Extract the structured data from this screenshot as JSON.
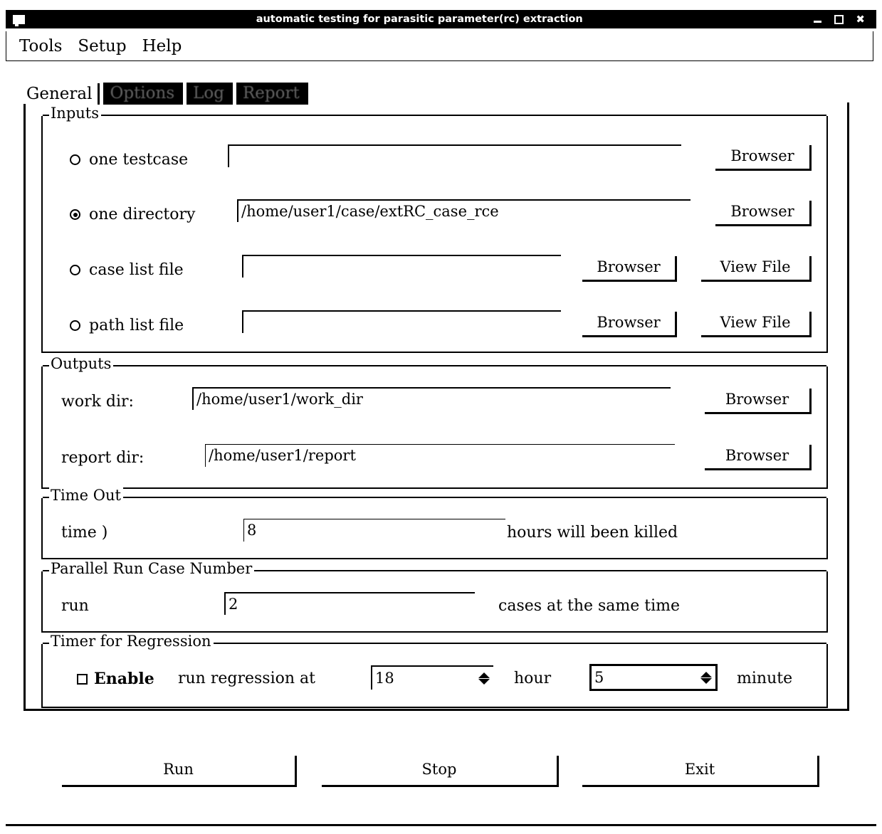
{
  "window": {
    "title": "automatic testing for parasitic parameter(rc) extraction",
    "icon": "window-menu-icon",
    "controls": {
      "minimize": "minimize-icon",
      "maximize": "maximize-icon",
      "close": "close-icon"
    }
  },
  "menubar": {
    "items": [
      {
        "label": "Tools"
      },
      {
        "label": "Setup"
      },
      {
        "label": "Help"
      }
    ]
  },
  "tabs": [
    {
      "label": "General",
      "active": true
    },
    {
      "label": "Options",
      "active": false
    },
    {
      "label": "Log",
      "active": false
    },
    {
      "label": "Report",
      "active": false
    }
  ],
  "inputs": {
    "legend": "Inputs",
    "rows": [
      {
        "label": "one testcase",
        "selected": false,
        "value": "",
        "browser": "Browser",
        "view": null
      },
      {
        "label": "one directory",
        "selected": true,
        "value": "/home/user1/case/extRC_case_rce",
        "browser": "Browser",
        "view": null
      },
      {
        "label": "case list file",
        "selected": false,
        "value": "",
        "browser": "Browser",
        "view": "View File"
      },
      {
        "label": "path list file",
        "selected": false,
        "value": "",
        "browser": "Browser",
        "view": "View File"
      }
    ]
  },
  "outputs": {
    "legend": "Outputs",
    "rows": [
      {
        "label": "work dir:",
        "value": "/home/user1/work_dir",
        "browser": "Browser"
      },
      {
        "label": "report dir:",
        "value": "/home/user1/report",
        "browser": "Browser"
      }
    ]
  },
  "timeout": {
    "legend": "Time Out",
    "label": "time )",
    "value": "8",
    "suffix": "hours will been killed"
  },
  "parallel": {
    "legend": "Parallel Run Case Number",
    "label": "run",
    "value": "2",
    "suffix": "cases at the same time"
  },
  "timer": {
    "legend": "Timer for Regression",
    "enable_label": "Enable",
    "enabled": false,
    "prefix": "run regression at",
    "hour_value": "18",
    "hour_label": "hour",
    "minute_value": "5",
    "minute_label": "minute"
  },
  "actions": [
    {
      "label": "Run"
    },
    {
      "label": "Stop"
    },
    {
      "label": "Exit"
    }
  ],
  "colors": {
    "foreground": "#000000",
    "background": "#ffffff",
    "titlebar_bg": "#000000",
    "titlebar_fg": "#ffffff"
  }
}
